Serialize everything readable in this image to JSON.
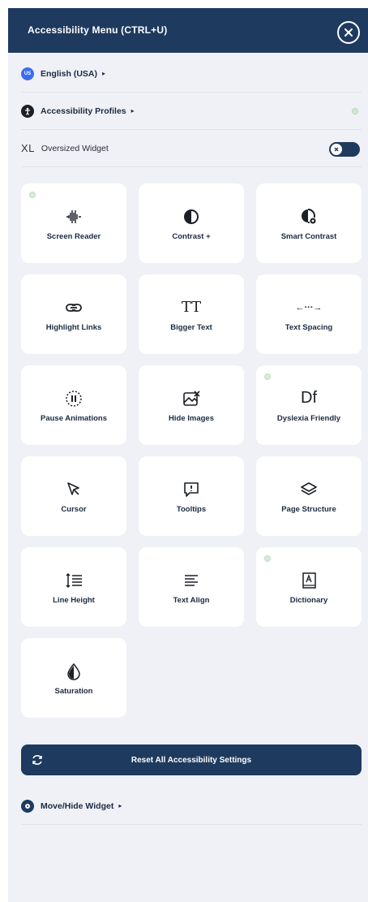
{
  "header": {
    "title": "Accessibility Menu (CTRL+U)"
  },
  "language": {
    "flag": "US",
    "label": "English (USA)",
    "caret": "▸"
  },
  "profiles": {
    "label": "Accessibility Profiles",
    "caret": "▸"
  },
  "oversized": {
    "prefix": "XL",
    "label": "Oversized Widget"
  },
  "tiles": [
    {
      "label": "Screen Reader",
      "icon": "sound-wave-icon"
    },
    {
      "label": "Contrast +",
      "icon": "contrast-icon"
    },
    {
      "label": "Smart Contrast",
      "icon": "smart-contrast-icon"
    },
    {
      "label": "Highlight Links",
      "icon": "link-icon"
    },
    {
      "label": "Bigger Text",
      "icon_text": "TT"
    },
    {
      "label": "Text Spacing",
      "icon_text": "←···→"
    },
    {
      "label": "Pause Animations",
      "icon": "pause-icon"
    },
    {
      "label": "Hide Images",
      "icon": "hide-image-icon"
    },
    {
      "label": "Dyslexia Friendly",
      "icon_text": "Df"
    },
    {
      "label": "Cursor",
      "icon": "cursor-icon"
    },
    {
      "label": "Tooltips",
      "icon": "tooltip-icon"
    },
    {
      "label": "Page Structure",
      "icon": "layers-icon"
    },
    {
      "label": "Line Height",
      "icon": "line-height-icon"
    },
    {
      "label": "Text Align",
      "icon": "text-align-icon"
    },
    {
      "label": "Dictionary",
      "icon": "dictionary-icon"
    },
    {
      "label": "Saturation",
      "icon": "drop-icon"
    }
  ],
  "reset": {
    "label": "Reset All Accessibility Settings"
  },
  "move": {
    "label": "Move/Hide Widget",
    "caret": "▸"
  },
  "colors": {
    "brand": "#1e3a5f",
    "background": "#eff1f7",
    "tile": "#ffffff"
  }
}
